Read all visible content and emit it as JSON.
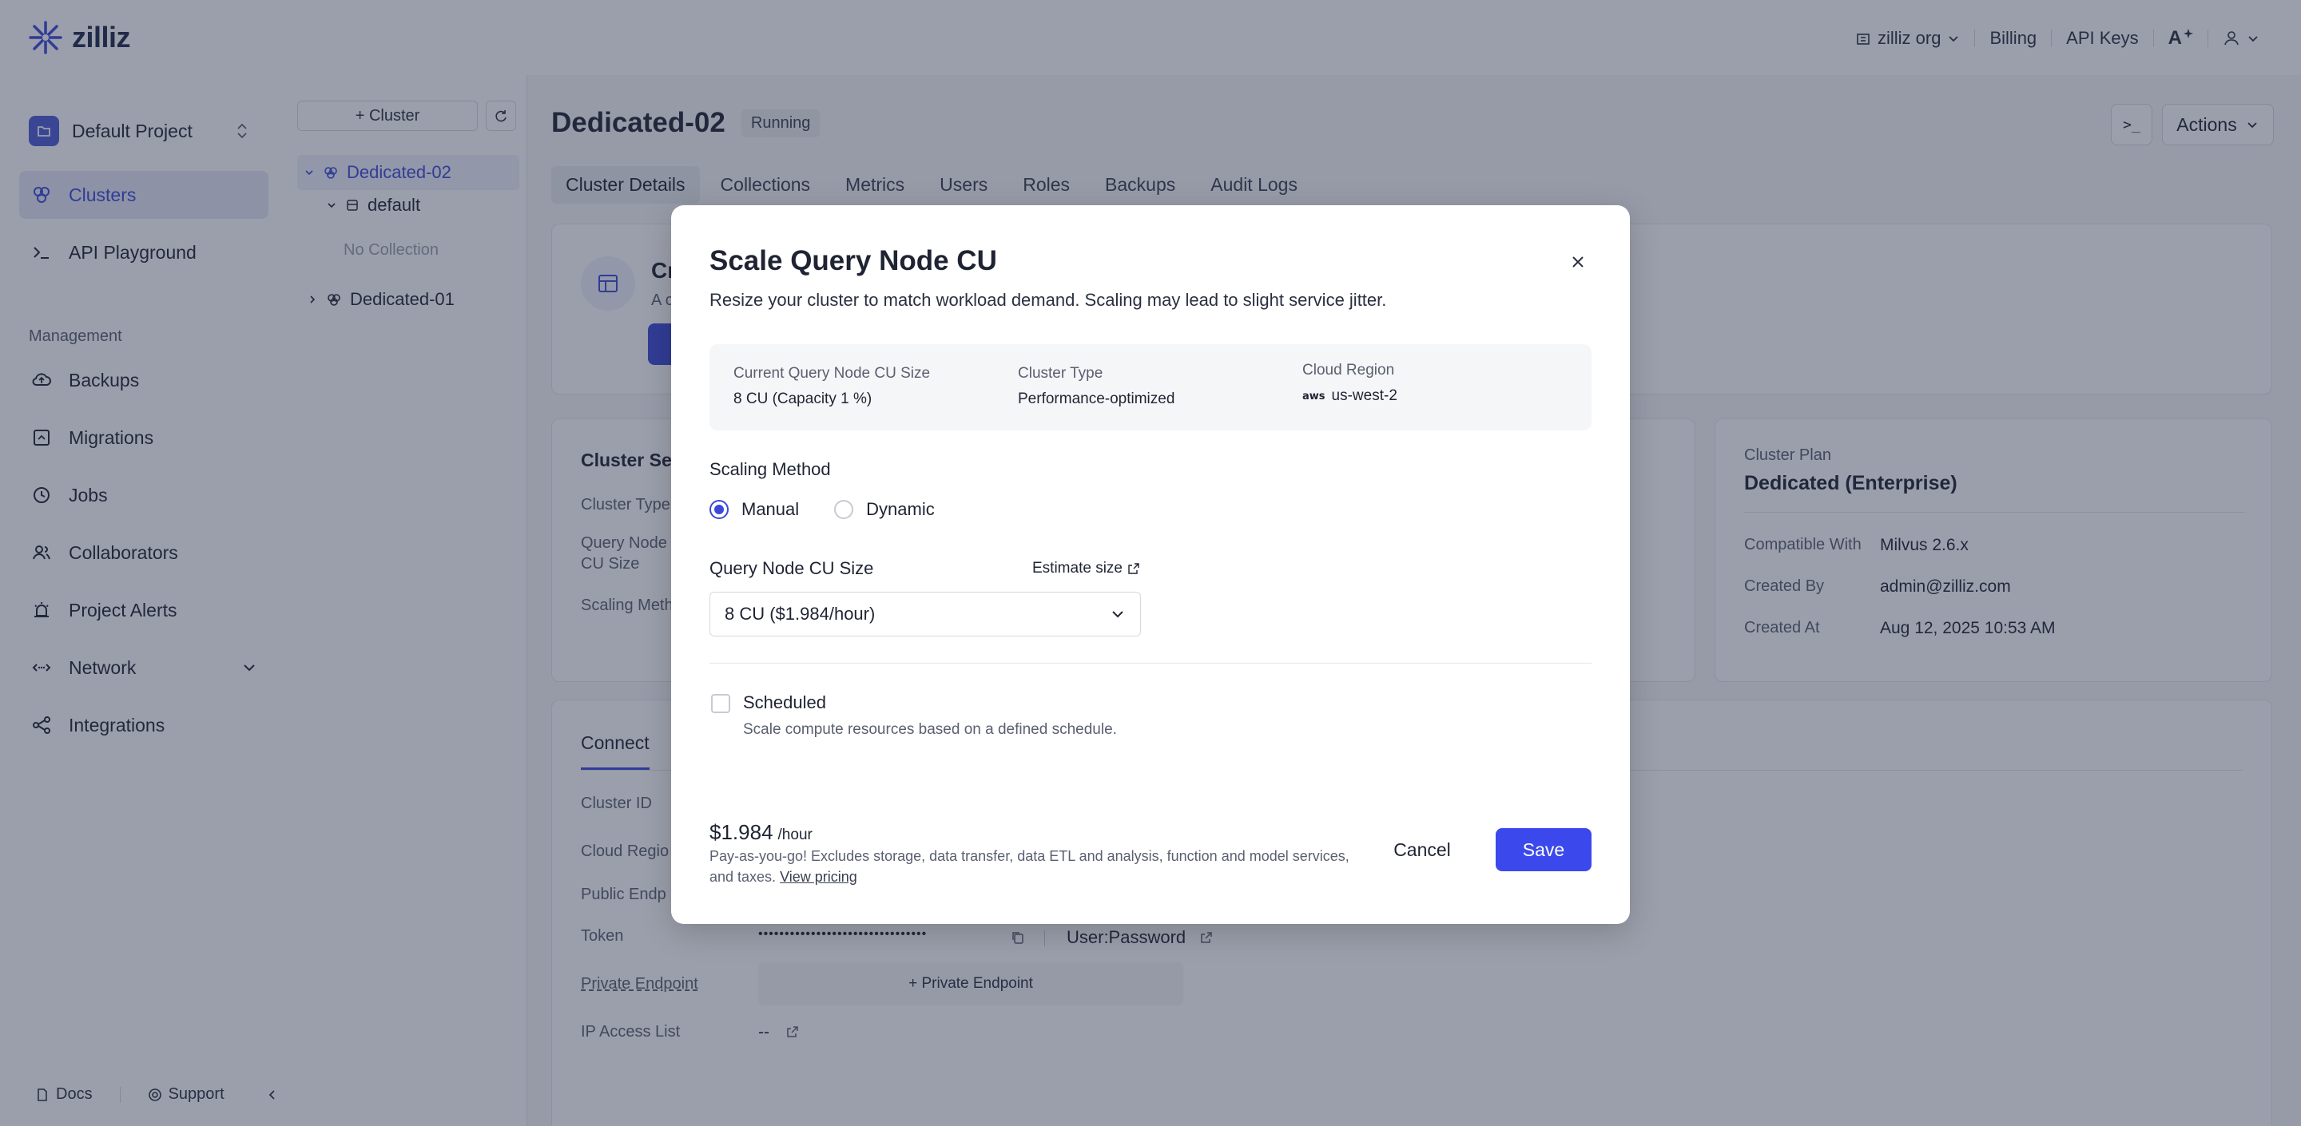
{
  "header": {
    "logo_text": "zilliz",
    "org": "zilliz org",
    "billing": "Billing",
    "api_keys": "API Keys",
    "font_icon_text": "A"
  },
  "sidebar": {
    "project": "Default Project",
    "items": [
      {
        "label": "Clusters",
        "icon": "clusters-icon",
        "active": true
      },
      {
        "label": "API Playground",
        "icon": "terminal-icon",
        "active": false
      }
    ],
    "section_label": "Management",
    "management": [
      {
        "label": "Backups",
        "icon": "cloud-backup-icon"
      },
      {
        "label": "Migrations",
        "icon": "migrations-icon"
      },
      {
        "label": "Jobs",
        "icon": "clock-icon"
      },
      {
        "label": "Collaborators",
        "icon": "users-icon"
      },
      {
        "label": "Project Alerts",
        "icon": "alarm-icon"
      },
      {
        "label": "Network",
        "icon": "network-icon"
      },
      {
        "label": "Integrations",
        "icon": "integrations-icon"
      }
    ],
    "docs": "Docs",
    "support": "Support"
  },
  "tree": {
    "add_cluster": "+ Cluster",
    "cluster_1": "Dedicated-02",
    "db": "default",
    "empty": "No Collection",
    "cluster_2": "Dedicated-01"
  },
  "main": {
    "title": "Dedicated-02",
    "status": "Running",
    "actions": "Actions",
    "term": ">_",
    "tabs": [
      "Cluster Details",
      "Collections",
      "Metrics",
      "Users",
      "Roles",
      "Backups",
      "Audit Logs"
    ],
    "banner_title": "Cr",
    "banner_sub": "A c",
    "settings": {
      "title": "Cluster Set",
      "cluster_type": "Cluster Type",
      "query_node_1": "Query Node",
      "query_node_2": "CU Size",
      "scaling": "Scaling Meth"
    },
    "plan": {
      "label": "Cluster Plan",
      "value": "Dedicated (Enterprise)",
      "compat_l": "Compatible With",
      "compat_v": "Milvus 2.6.x",
      "created_by_l": "Created By",
      "created_by_v": "admin@zilliz.com",
      "created_at_l": "Created At",
      "created_at_v": "Aug 12, 2025 10:53 AM"
    },
    "connect": {
      "tab": "Connect",
      "cluster_id": "Cluster ID",
      "cloud_region": "Cloud Regio",
      "public_endpoint": "Public Endp",
      "token_l": "Token",
      "token_v": "••••••••••••••••••••••••••••••••",
      "user_password": "User:Password",
      "private_l": "Private Endpoint",
      "private_btn": "+ Private Endpoint",
      "ip_l": "IP Access List",
      "ip_v": "--"
    }
  },
  "modal": {
    "title": "Scale Query Node CU",
    "subtitle": "Resize your cluster to match workload demand. Scaling may lead to slight service jitter.",
    "info": {
      "cu_size_l": "Current Query Node CU Size",
      "cu_size_v": "8 CU (Capacity 1 %)",
      "type_l": "Cluster Type",
      "type_v": "Performance-optimized",
      "region_l": "Cloud Region",
      "region_badge": "aws",
      "region_v": "us-west-2"
    },
    "scaling_label": "Scaling Method",
    "manual": "Manual",
    "dynamic": "Dynamic",
    "cu_label": "Query Node CU Size",
    "estimate": "Estimate size",
    "cu_select": "8 CU ($1.984/hour)",
    "scheduled": "Scheduled",
    "scheduled_desc": "Scale compute resources based on a defined schedule.",
    "price": "$1.984",
    "price_unit": "/hour",
    "price_note": "Pay-as-you-go! Excludes storage, data transfer, data ETL and analysis, function and model services, and taxes.",
    "view_pricing": "View pricing",
    "cancel": "Cancel",
    "save": "Save"
  },
  "colors": {
    "accent": "#3b49ec",
    "overlay": "#262e48"
  }
}
